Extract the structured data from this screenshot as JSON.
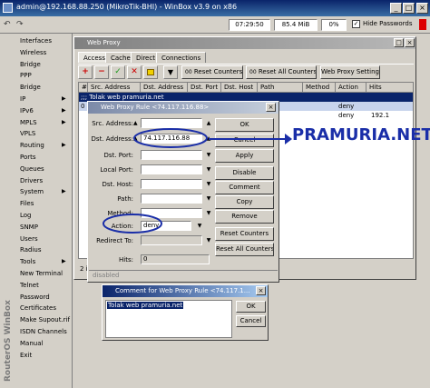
{
  "window": {
    "title": "admin@192.168.88.250 (MikroTik-BHI) - WinBox v3.9 on x86"
  },
  "toolbar": {
    "clock": "07:29:50",
    "memory": "85.4 MiB",
    "cpu": "0%",
    "hide_passwords_label": "Hide Passwords"
  },
  "sidebar": {
    "items": [
      {
        "label": "Interfaces",
        "arrow": ""
      },
      {
        "label": "Wireless",
        "arrow": ""
      },
      {
        "label": "Bridge",
        "arrow": ""
      },
      {
        "label": "PPP",
        "arrow": ""
      },
      {
        "label": "Bridge",
        "arrow": ""
      },
      {
        "label": "IP",
        "arrow": "▶"
      },
      {
        "label": "IPv6",
        "arrow": "▶"
      },
      {
        "label": "MPLS",
        "arrow": "▶"
      },
      {
        "label": "VPLS",
        "arrow": ""
      },
      {
        "label": "Routing",
        "arrow": "▶"
      },
      {
        "label": "Ports",
        "arrow": ""
      },
      {
        "label": "Queues",
        "arrow": ""
      },
      {
        "label": "Drivers",
        "arrow": ""
      },
      {
        "label": "System",
        "arrow": "▶"
      },
      {
        "label": "Files",
        "arrow": ""
      },
      {
        "label": "Log",
        "arrow": ""
      },
      {
        "label": "SNMP",
        "arrow": ""
      },
      {
        "label": "Users",
        "arrow": ""
      },
      {
        "label": "Radius",
        "arrow": ""
      },
      {
        "label": "Tools",
        "arrow": "▶"
      },
      {
        "label": "New Terminal",
        "arrow": ""
      },
      {
        "label": "Telnet",
        "arrow": ""
      },
      {
        "label": "Password",
        "arrow": ""
      },
      {
        "label": "Certificates",
        "arrow": ""
      },
      {
        "label": "Make Supout.rif",
        "arrow": ""
      },
      {
        "label": "ISDN Channels",
        "arrow": ""
      },
      {
        "label": "Manual",
        "arrow": ""
      },
      {
        "label": "Exit",
        "arrow": ""
      }
    ],
    "vertical_text": "RouterOS WinBox"
  },
  "web_proxy": {
    "title": "Web Proxy",
    "tabs": [
      "Access",
      "Cache",
      "Direct",
      "Connections"
    ],
    "buttons": {
      "reset_counters": "Reset Counters",
      "reset_all_counters": "Reset All Counters",
      "settings": "Web Proxy Settings"
    },
    "columns": [
      "#",
      "Src. Address",
      "Dst. Address",
      "Dst. Port",
      "Dst. Host",
      "Path",
      "Method",
      "Action",
      "Hits"
    ],
    "comment_row": ";;; Tolak web pramuria.net",
    "row_first_cell": "0",
    "row_action_1": "deny",
    "row_action_2": "deny",
    "row_hits": "192.1",
    "items_status": "2 ite"
  },
  "rule_dialog": {
    "title": "Web Proxy Rule <74.117.116.88>",
    "labels": {
      "src_address": "Src. Address:",
      "dst_address": "Dst. Address:",
      "dst_port": "Dst. Port:",
      "local_port": "Local Port:",
      "dst_host": "Dst. Host:",
      "path": "Path:",
      "method": "Method:",
      "action": "Action:",
      "redirect_to": "Redirect To:",
      "hits": "Hits:"
    },
    "values": {
      "dst_address": "74.117.116.88",
      "action": "deny",
      "hits": "0"
    },
    "buttons": [
      "OK",
      "Cancel",
      "Apply",
      "Disable",
      "Comment",
      "Copy",
      "Remove",
      "Reset Counters",
      "Reset All Counters"
    ],
    "status": "disabled"
  },
  "comment_dialog": {
    "title": "Comment for Web Proxy Rule <74.117.1...",
    "text": "Tolak web pramuria.net",
    "buttons": [
      "OK",
      "Cancel"
    ]
  },
  "annotation": {
    "text": "PRAMURIA.NET",
    "color": "#1a2ea8"
  }
}
